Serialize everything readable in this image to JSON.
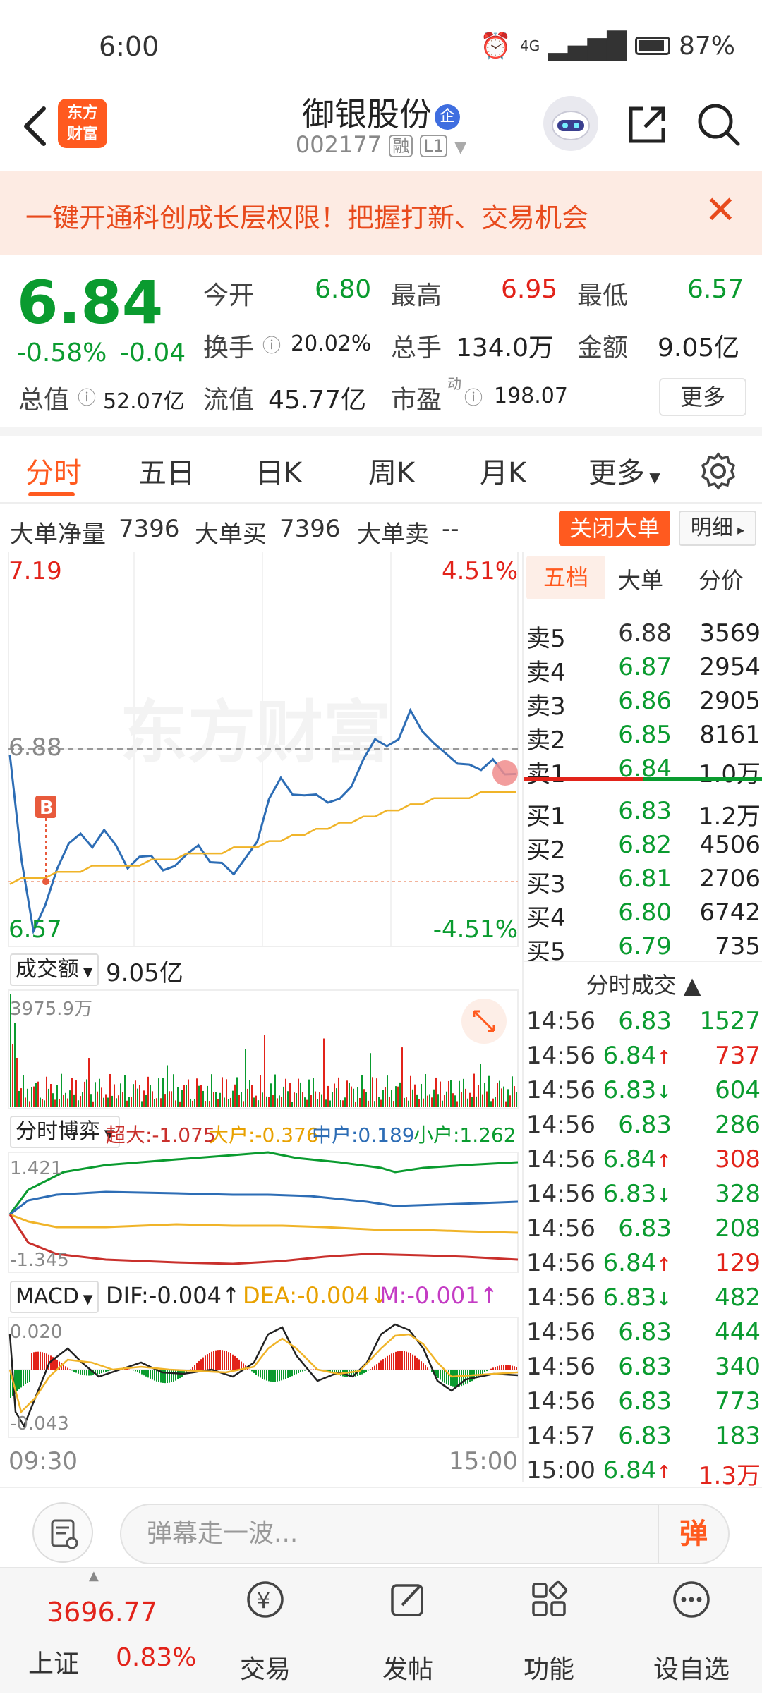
{
  "status": {
    "time": "6:00",
    "network": "4G",
    "battery": "87%"
  },
  "header": {
    "logo_line1": "东方",
    "logo_line2": "财富",
    "name": "御银股份",
    "badge": "企",
    "code": "002177",
    "tag_margin": "融",
    "tag_level": "L1"
  },
  "banner": {
    "text": "一键开通科创成长层权限！把握打新、交易机会"
  },
  "quote": {
    "price": "6.84",
    "change_pct": "-0.58%",
    "change": "-0.04",
    "open_label": "今开",
    "open": "6.80",
    "high_label": "最高",
    "high": "6.95",
    "low_label": "最低",
    "low": "6.57",
    "turnover_label": "换手",
    "turnover": "20.02%",
    "volume_label": "总手",
    "volume": "134.0万",
    "amount_label": "金额",
    "amount": "9.05亿",
    "mktcap_label": "总值",
    "mktcap": "52.07亿",
    "float_label": "流值",
    "float": "45.77亿",
    "pe_label": "市盈",
    "pe_sup": "动",
    "pe": "198.07",
    "more": "更多"
  },
  "tabs": [
    "分时",
    "五日",
    "日K",
    "周K",
    "月K",
    "更多"
  ],
  "big_order": {
    "net_label": "大单净量",
    "net": "7396",
    "buy_label": "大单买",
    "buy": "7396",
    "sell_label": "大单卖",
    "sell": "--",
    "close_btn": "关闭大单",
    "detail_btn": "明细"
  },
  "chart": {
    "price_max": "7.19",
    "price_min": "6.57",
    "pct_max": "4.51%",
    "pct_min": "-4.51%",
    "ref_price": "6.88",
    "marker": "B",
    "watermark": "东方财富",
    "vol_label": "成交额",
    "vol_total": "9.05亿",
    "vol_max": "3975.9万",
    "flow_label": "分时博弈",
    "flow_super": "超大:-1.075",
    "flow_large": "大户:-0.376",
    "flow_mid": "中户:0.189",
    "flow_small": "小户:1.262",
    "flow_max": "1.421",
    "flow_min": "-1.345",
    "macd_label": "MACD",
    "dif": "DIF:-0.004",
    "dea": "DEA:-0.004",
    "m": "M:-0.001",
    "macd_max": "0.020",
    "macd_min": "-0.043",
    "time_start": "09:30",
    "time_end": "15:00"
  },
  "chart_data": {
    "type": "line",
    "title": "",
    "ylim": [
      6.57,
      7.19
    ],
    "series": [
      {
        "name": "",
        "values": [
          6.87,
          6.7,
          6.58,
          6.63,
          6.68,
          6.73,
          6.74,
          6.72,
          6.75,
          6.72,
          6.69,
          6.7,
          6.71,
          6.68,
          6.69,
          6.71,
          6.72,
          6.7,
          6.69,
          6.68,
          6.7,
          6.73,
          6.8,
          6.83,
          6.81,
          6.8,
          6.81,
          6.79,
          6.8,
          6.82,
          6.86,
          6.9,
          6.88,
          6.9,
          6.94,
          6.91,
          6.89,
          6.87,
          6.86,
          6.85,
          6.85,
          6.86,
          6.84,
          6.84
        ]
      },
      {
        "name": "",
        "values": [
          6.66,
          6.67,
          6.67,
          6.67,
          6.68,
          6.68,
          6.68,
          6.69,
          6.69,
          6.69,
          6.69,
          6.69,
          6.7,
          6.7,
          6.7,
          6.71,
          6.71,
          6.71,
          6.71,
          6.72,
          6.72,
          6.72,
          6.73,
          6.73,
          6.74,
          6.74,
          6.75,
          6.75,
          6.76,
          6.76,
          6.77,
          6.77,
          6.78,
          6.78,
          6.79,
          6.79,
          6.8,
          6.8,
          6.8,
          6.8,
          6.81,
          6.81,
          6.81,
          6.81
        ]
      }
    ]
  },
  "book": {
    "tabs": [
      "五档",
      "大单",
      "分价"
    ],
    "asks": [
      {
        "label": "卖5",
        "price": "6.88",
        "vol": "3569"
      },
      {
        "label": "卖4",
        "price": "6.87",
        "vol": "2954"
      },
      {
        "label": "卖3",
        "price": "6.86",
        "vol": "2905"
      },
      {
        "label": "卖2",
        "price": "6.85",
        "vol": "8161"
      },
      {
        "label": "卖1",
        "price": "6.84",
        "vol": "1.0万"
      }
    ],
    "bids": [
      {
        "label": "买1",
        "price": "6.83",
        "vol": "1.2万"
      },
      {
        "label": "买2",
        "price": "6.82",
        "vol": "4506"
      },
      {
        "label": "买3",
        "price": "6.81",
        "vol": "2706"
      },
      {
        "label": "买4",
        "price": "6.80",
        "vol": "6742"
      },
      {
        "label": "买5",
        "price": "6.79",
        "vol": "735"
      }
    ],
    "ticks_title": "分时成交",
    "ticks": [
      {
        "t": "14:56",
        "p": "6.83",
        "v": "1527",
        "d": ""
      },
      {
        "t": "14:56",
        "p": "6.84",
        "v": "737",
        "d": "up"
      },
      {
        "t": "14:56",
        "p": "6.83",
        "v": "604",
        "d": "down"
      },
      {
        "t": "14:56",
        "p": "6.83",
        "v": "286",
        "d": ""
      },
      {
        "t": "14:56",
        "p": "6.84",
        "v": "308",
        "d": "up"
      },
      {
        "t": "14:56",
        "p": "6.83",
        "v": "328",
        "d": "down"
      },
      {
        "t": "14:56",
        "p": "6.83",
        "v": "208",
        "d": ""
      },
      {
        "t": "14:56",
        "p": "6.84",
        "v": "129",
        "d": "up"
      },
      {
        "t": "14:56",
        "p": "6.83",
        "v": "482",
        "d": "down"
      },
      {
        "t": "14:56",
        "p": "6.83",
        "v": "444",
        "d": ""
      },
      {
        "t": "14:56",
        "p": "6.83",
        "v": "340",
        "d": ""
      },
      {
        "t": "14:56",
        "p": "6.83",
        "v": "773",
        "d": ""
      },
      {
        "t": "14:57",
        "p": "6.83",
        "v": "183",
        "d": ""
      },
      {
        "t": "15:00",
        "p": "6.84",
        "v": "1.3万",
        "d": "up"
      }
    ]
  },
  "comment": {
    "placeholder": "弹幕走一波...",
    "danmu": "弹"
  },
  "nav": {
    "index_value": "3696.77",
    "index_name": "上证",
    "index_pct": "0.83%",
    "items": [
      "交易",
      "发帖",
      "功能",
      "设自选"
    ]
  },
  "colors": {
    "up": "#e2231a",
    "down": "#0a9b2f",
    "accent": "#ff5a1f",
    "price_line": "#2d6db5",
    "avg_line": "#f0b429"
  }
}
